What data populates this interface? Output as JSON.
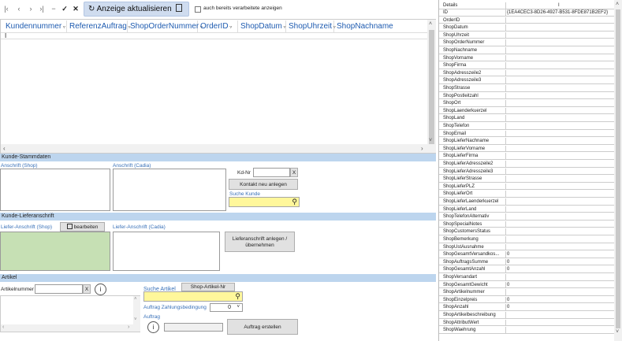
{
  "toolbar": {
    "refresh_label": "Anzeige aktualisieren",
    "checkbox_label": "auch bereits verarbeitete anzeigen"
  },
  "grid": {
    "columns": [
      "Kundennummer",
      "ReferenzAuftrag",
      "ShopOrderNummer",
      "OrderID",
      "ShopDatum",
      "ShopUhrzeit",
      "ShopNachname"
    ]
  },
  "kunde": {
    "section_title": "Kunde-Stammdaten",
    "anschrift_shop": "Anschrift (Shop)",
    "anschrift_cadia": "Anschrift (Cadia)",
    "kdnr_label": "Kd-Nr",
    "clear": "X",
    "kontakt_button": "Kontakt neu anlegen",
    "suche_kunde": "Suche Kunde"
  },
  "liefer": {
    "section_title": "Kunde-Lieferanschrift",
    "liefer_shop": "Liefer-Anschrift (Shop)",
    "bearbeiten": "bearbeiten",
    "liefer_cadia": "Liefer-Anschrift (Cadia)",
    "anlegen_button": "Lieferanschrift anlegen / übernehmen"
  },
  "artikel": {
    "section_title": "Artikel",
    "artikelnummer": "Artikelnummer",
    "clear": "X",
    "suche_artikel": "Suche Artikel",
    "shop_artikel_nr": "Shop-Artikel-Nr",
    "zahlungsbedingung": "Auftrag Zahlungsbedingung",
    "zahlung_value": "0",
    "auftrag_label": "Auftrag",
    "auftrag_erstellen": "Auftrag erstellen"
  },
  "details": {
    "header": "Details",
    "rows": [
      {
        "name": "ID",
        "value": "{1EA4CEC3-8D26-4927-B531-8FDE871B2EF2}"
      },
      {
        "name": "OrderID",
        "value": ""
      },
      {
        "name": "ShopDatum",
        "value": ""
      },
      {
        "name": "ShopUhrzeit",
        "value": ""
      },
      {
        "name": "ShopOrderNummer",
        "value": ""
      },
      {
        "name": "ShopNachname",
        "value": ""
      },
      {
        "name": "ShopVorname",
        "value": ""
      },
      {
        "name": "ShopFirma",
        "value": ""
      },
      {
        "name": "ShopAdresszeile2",
        "value": ""
      },
      {
        "name": "ShopAdresszeile3",
        "value": ""
      },
      {
        "name": "ShopStrasse",
        "value": ""
      },
      {
        "name": "ShopPostleitzahl",
        "value": ""
      },
      {
        "name": "ShopOrt",
        "value": ""
      },
      {
        "name": "ShopLaenderkuerzel",
        "value": ""
      },
      {
        "name": "ShopLand",
        "value": ""
      },
      {
        "name": "ShopTelefon",
        "value": ""
      },
      {
        "name": "ShopEmail",
        "value": ""
      },
      {
        "name": "ShopLieferNachname",
        "value": ""
      },
      {
        "name": "ShopLieferVorname",
        "value": ""
      },
      {
        "name": "ShopLieferFirma",
        "value": ""
      },
      {
        "name": "ShopLieferAdresszeile2",
        "value": ""
      },
      {
        "name": "ShopLieferAdresszeile3",
        "value": ""
      },
      {
        "name": "ShopLieferStrasse",
        "value": ""
      },
      {
        "name": "ShopLieferPLZ",
        "value": ""
      },
      {
        "name": "ShopLieferOrt",
        "value": ""
      },
      {
        "name": "ShopLieferLaenderkuerzel",
        "value": ""
      },
      {
        "name": "ShopLieferLand",
        "value": ""
      },
      {
        "name": "ShopTelefonAlternativ",
        "value": ""
      },
      {
        "name": "ShopSpecialNotes",
        "value": ""
      },
      {
        "name": "ShopCustomersStatus",
        "value": ""
      },
      {
        "name": "ShopBemerkung",
        "value": ""
      },
      {
        "name": "ShopUstAusnahme",
        "value": ""
      },
      {
        "name": "ShopGesamtVersandkos...",
        "value": "0"
      },
      {
        "name": "ShopAuftragsSumme",
        "value": "0"
      },
      {
        "name": "ShopGesamtAnzahl",
        "value": "0"
      },
      {
        "name": "ShopVersandart",
        "value": ""
      },
      {
        "name": "ShopGesamtGewicht",
        "value": "0"
      },
      {
        "name": "ShopArtikelnummer",
        "value": ""
      },
      {
        "name": "ShopEinzelpreis",
        "value": "0"
      },
      {
        "name": "ShopAnzahl",
        "value": "0"
      },
      {
        "name": "ShopArtikelbeschreibung",
        "value": ""
      },
      {
        "name": "ShopAttributWert",
        "value": ""
      },
      {
        "name": "ShopWaehrung",
        "value": ""
      }
    ]
  }
}
